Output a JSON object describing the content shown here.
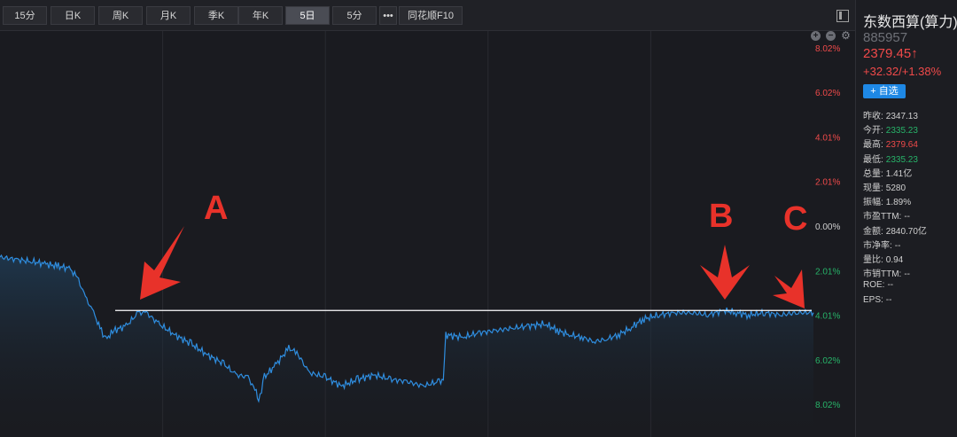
{
  "toolbar": {
    "tabs": [
      {
        "label": "15分",
        "active": false
      },
      {
        "label": "日K",
        "active": false
      },
      {
        "label": "周K",
        "active": false
      },
      {
        "label": "月K",
        "active": false
      },
      {
        "label": "季K",
        "active": false
      },
      {
        "label": "年K",
        "active": false
      },
      {
        "label": "5日",
        "active": true
      },
      {
        "label": "5分",
        "active": false
      },
      {
        "label": "•••",
        "active": false
      },
      {
        "label": "同花顺F10",
        "active": false
      }
    ]
  },
  "stock": {
    "name": "东数西算(算力)",
    "code": "885957",
    "price": "2379.45↑",
    "change": "+32.32/+1.38%",
    "add_watch": "+ 自选"
  },
  "stats": [
    {
      "label": "昨收:",
      "value": "2347.13",
      "color": "white"
    },
    {
      "label": "今开:",
      "value": "2335.23",
      "color": "green"
    },
    {
      "label": "最高:",
      "value": "2379.64",
      "color": "red"
    },
    {
      "label": "最低:",
      "value": "2335.23",
      "color": "green"
    },
    {
      "label": "总量:",
      "value": "1.41亿",
      "color": "white"
    },
    {
      "label": "现量:",
      "value": "5280",
      "color": "white"
    },
    {
      "label": "振幅:",
      "value": "1.89%",
      "color": "white"
    },
    {
      "label": "市盈TTM:",
      "value": "--",
      "color": "white"
    },
    {
      "label": "金额:",
      "value": "2840.70亿",
      "color": "white"
    },
    {
      "label": "市净率:",
      "value": "--",
      "color": "white"
    },
    {
      "label": "量比:",
      "value": "0.94",
      "color": "white"
    },
    {
      "label": "市销TTM:",
      "value": "--",
      "color": "white"
    },
    {
      "label": "ROE:",
      "value": "--",
      "color": "white"
    },
    {
      "label": "EPS:",
      "value": "--",
      "color": "white"
    }
  ],
  "annotations": {
    "a": "A",
    "b": "B",
    "c": "C"
  },
  "colors": {
    "line": "#2f8ee0",
    "up": "#f04a4a",
    "down": "#27b469",
    "flat": "#d0d0d0",
    "arrow": "#e8322a"
  },
  "chart_data": {
    "type": "line",
    "ylim": [
      -8.02,
      8.02
    ],
    "y_ticks": [
      {
        "value": 8.02,
        "label": "8.02%"
      },
      {
        "value": 6.02,
        "label": "6.02%"
      },
      {
        "value": 4.01,
        "label": "4.01%"
      },
      {
        "value": 2.01,
        "label": "2.01%"
      },
      {
        "value": 0,
        "label": "0.00%"
      },
      {
        "value": -2.01,
        "label": "2.01%"
      },
      {
        "value": -4.01,
        "label": "4.01%"
      },
      {
        "value": -6.02,
        "label": "6.02%"
      },
      {
        "value": -8.02,
        "label": "8.02%"
      }
    ],
    "days": 5,
    "reference_level": -3.8,
    "series": [
      {
        "values": [
          [
            0.0,
            -1.4
          ],
          [
            0.02,
            -1.5
          ],
          [
            0.04,
            -1.6
          ],
          [
            0.055,
            -1.7
          ],
          [
            0.07,
            -1.8
          ],
          [
            0.085,
            -1.9
          ],
          [
            0.095,
            -2.3
          ],
          [
            0.105,
            -3.2
          ],
          [
            0.115,
            -3.9
          ],
          [
            0.123,
            -4.6
          ],
          [
            0.13,
            -5.1
          ],
          [
            0.14,
            -4.7
          ],
          [
            0.155,
            -4.5
          ],
          [
            0.17,
            -3.9
          ],
          [
            0.18,
            -3.9
          ],
          [
            0.195,
            -4.4
          ],
          [
            0.215,
            -4.9
          ],
          [
            0.235,
            -5.3
          ],
          [
            0.255,
            -5.8
          ],
          [
            0.275,
            -6.2
          ],
          [
            0.29,
            -6.7
          ],
          [
            0.305,
            -6.8
          ],
          [
            0.315,
            -7.5
          ],
          [
            0.318,
            -7.9
          ],
          [
            0.325,
            -6.8
          ],
          [
            0.34,
            -6.2
          ],
          [
            0.355,
            -5.5
          ],
          [
            0.365,
            -5.7
          ],
          [
            0.38,
            -6.6
          ],
          [
            0.4,
            -6.8
          ],
          [
            0.42,
            -7.2
          ],
          [
            0.44,
            -6.9
          ],
          [
            0.46,
            -6.7
          ],
          [
            0.48,
            -6.9
          ],
          [
            0.5,
            -7.0
          ],
          [
            0.52,
            -7.2
          ],
          [
            0.54,
            -7.0
          ],
          [
            0.545,
            -6.9
          ],
          [
            0.548,
            -4.9
          ],
          [
            0.57,
            -5.0
          ],
          [
            0.59,
            -4.8
          ],
          [
            0.61,
            -4.7
          ],
          [
            0.63,
            -4.6
          ],
          [
            0.65,
            -4.5
          ],
          [
            0.67,
            -4.4
          ],
          [
            0.685,
            -4.7
          ],
          [
            0.7,
            -4.9
          ],
          [
            0.715,
            -5.0
          ],
          [
            0.73,
            -5.2
          ],
          [
            0.745,
            -5.1
          ],
          [
            0.76,
            -4.9
          ],
          [
            0.775,
            -4.6
          ],
          [
            0.79,
            -4.2
          ],
          [
            0.81,
            -4.0
          ],
          [
            0.83,
            -3.9
          ],
          [
            0.85,
            -3.9
          ],
          [
            0.87,
            -4.0
          ],
          [
            0.89,
            -3.8
          ],
          [
            0.905,
            -3.9
          ],
          [
            0.92,
            -4.0
          ],
          [
            0.94,
            -3.9
          ],
          [
            0.96,
            -4.0
          ],
          [
            0.98,
            -3.9
          ],
          [
            1.0,
            -3.9
          ]
        ]
      }
    ]
  }
}
